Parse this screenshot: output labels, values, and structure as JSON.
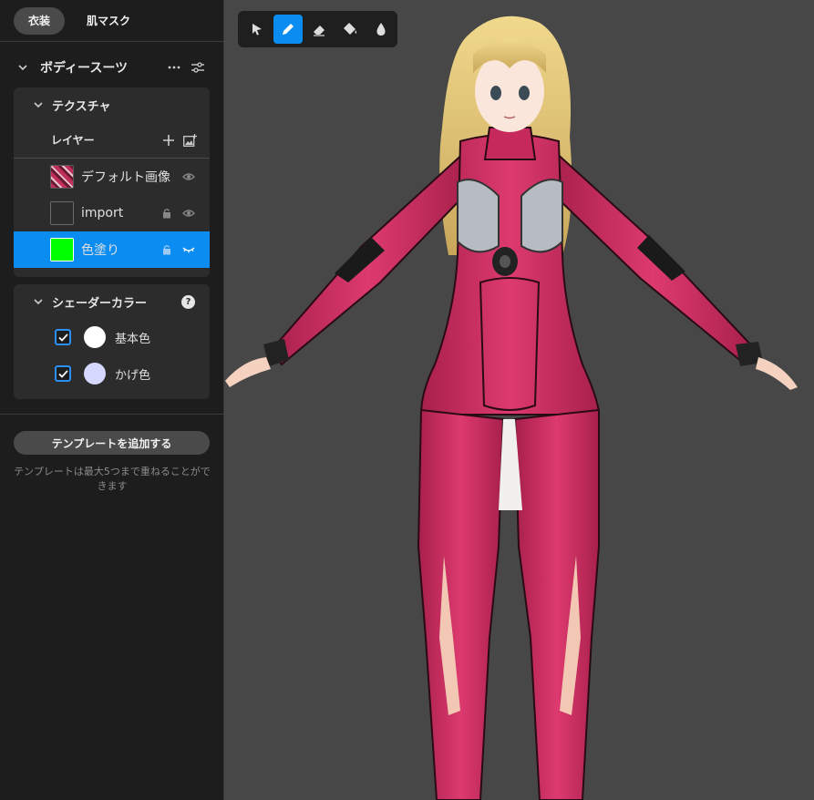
{
  "tabs": [
    {
      "label": "衣装",
      "active": true
    },
    {
      "label": "肌マスク",
      "active": false
    }
  ],
  "section": {
    "title": "ボディースーツ",
    "more_icon": "ellipsis-icon",
    "settings_icon": "sliders-icon"
  },
  "texture": {
    "title": "テクスチャ",
    "layers_title": "レイヤー",
    "layers": [
      {
        "name": "デフォルト画像",
        "thumb": "default",
        "locked": false,
        "visible": true,
        "selected": false
      },
      {
        "name": "import",
        "thumb": "empty",
        "locked": true,
        "visible": true,
        "selected": false
      },
      {
        "name": "色塗り",
        "thumb": "green",
        "locked": true,
        "visible": false,
        "selected": true
      }
    ]
  },
  "shader": {
    "title": "シェーダーカラー",
    "colors": [
      {
        "label": "基本色",
        "checked": true,
        "color": "#ffffff"
      },
      {
        "label": "かげ色",
        "checked": true,
        "color": "#d6d8ff"
      }
    ]
  },
  "add_template_label": "テンプレートを追加する",
  "template_hint": "テンプレートは最大5つまで重ねることができます",
  "tools": [
    "select-arrow-icon",
    "pencil-icon",
    "eraser-icon",
    "fill-bucket-icon",
    "eyedropper-drop-icon"
  ],
  "active_tool": "pencil-icon",
  "colors": {
    "accent": "#0a8cf0",
    "viewport_bg": "#474747",
    "sidebar_bg": "#1d1d1d",
    "suit_pink": "#d42f65",
    "hair_blonde": "#e8cd7a"
  }
}
